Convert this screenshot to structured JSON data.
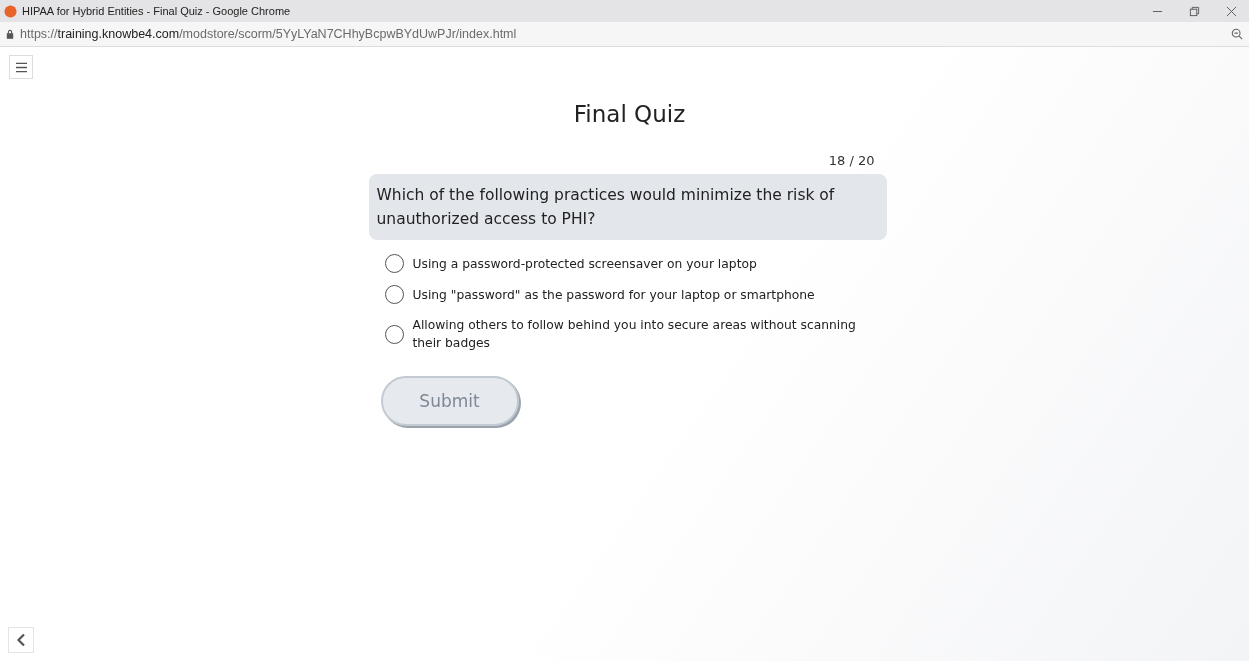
{
  "window": {
    "title": "HIPAA for Hybrid Entities - Final Quiz - Google Chrome"
  },
  "address_bar": {
    "url": "https://**training.knowbe4.com**/modstore/scorm/5YyLYaN7CHhyBcpwBYdUwPJr/index.html"
  },
  "quiz": {
    "title": "Final Quiz",
    "counter": "18 / 20",
    "question": "Which of the following practices would minimize the risk of unauthorized access to PHI?",
    "options": [
      {
        "label": "Using a password-protected screensaver on your laptop",
        "selected": false
      },
      {
        "label": "Using \"password\" as the password for your laptop or smartphone",
        "selected": false
      },
      {
        "label": "Allowing others to follow behind you into secure areas without scanning their badges",
        "selected": false
      }
    ],
    "submit": {
      "label": "Submit",
      "disabled": true
    }
  }
}
